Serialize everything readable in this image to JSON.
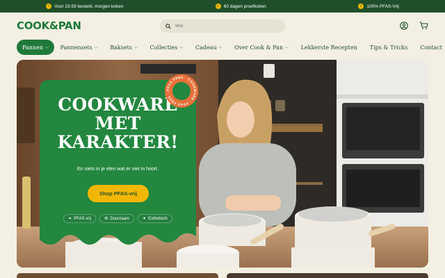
{
  "topbar": {
    "usps": [
      {
        "text": "Voor 23:59 besteld, morgen koken"
      },
      {
        "text": "60 dagen proefkoken"
      },
      {
        "text": "100% PFAS-Vrij"
      }
    ]
  },
  "header": {
    "logo": "COOK&PAN",
    "search_placeholder": "Wat",
    "icons": [
      "account-icon",
      "cart-icon"
    ]
  },
  "nav": {
    "items": [
      {
        "label": "Pannen",
        "dropdown": true,
        "active": true
      },
      {
        "label": "Pannensets",
        "dropdown": true
      },
      {
        "label": "Baksets",
        "dropdown": true
      },
      {
        "label": "Collecties",
        "dropdown": true
      },
      {
        "label": "Cadeau",
        "dropdown": true
      },
      {
        "label": "Over Cook & Pan",
        "dropdown": true
      },
      {
        "label": "Lekkerste Recepten",
        "dropdown": false
      },
      {
        "label": "Tips & Tricks",
        "dropdown": false
      },
      {
        "label": "Contact",
        "dropdown": false
      }
    ]
  },
  "hero": {
    "title": "COOKWARE\nMET\nKARAKTER!",
    "subtitle": "En niets in je eten wat er niet in hoort.",
    "cta_label": "Shop PFAS-vrij",
    "chips": [
      {
        "label": "PFAS vrij",
        "icon": "leaf-icon"
      },
      {
        "label": "Duurzaam",
        "icon": "recycle-icon"
      },
      {
        "label": "Esthetisch",
        "icon": "sparkle-icon"
      }
    ],
    "badge_text": "PFAS FREE · COOKWARE · PFAS FREE ·"
  },
  "colors": {
    "brand_green": "#1f7a3a",
    "dark_green": "#1f4f2a",
    "accent_yellow": "#f2b705",
    "badge_orange": "#e8703a",
    "background": "#f3efe3"
  }
}
